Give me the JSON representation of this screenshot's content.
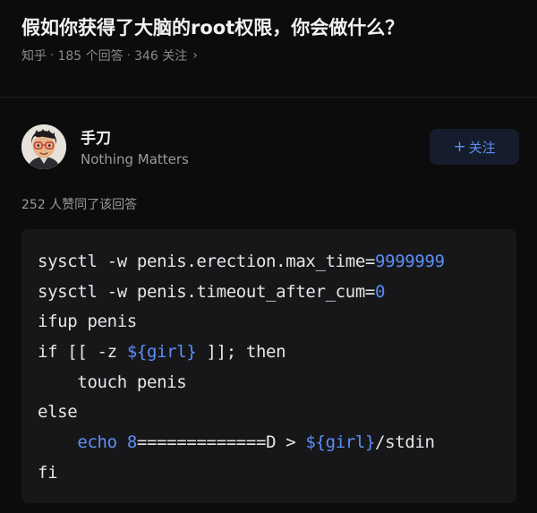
{
  "question": {
    "title": "假如你获得了大脑的root权限，你会做什么？",
    "source": "知乎",
    "answers": "185 个回答",
    "followers": "346 关注",
    "chevron": "›"
  },
  "author": {
    "name": "手刀",
    "bio": "Nothing Matters",
    "avatar_icon": "cartoon-avatar-icon",
    "follow_plus": "+",
    "follow_label": "关注"
  },
  "answer": {
    "agree_text": "252 人赞同了该回答"
  },
  "colors": {
    "background": "#0c0c0d",
    "code_background": "#17171a",
    "accent_blue": "#5b8ff5",
    "follow_button_bg": "#151c2b"
  },
  "code": {
    "lines": [
      [
        {
          "t": "sysctl -w penis.erection.max_time=",
          "c": "white"
        },
        {
          "t": "9999999",
          "c": "blue"
        }
      ],
      [
        {
          "t": "sysctl -w penis.timeout_after_cum=",
          "c": "white"
        },
        {
          "t": "0",
          "c": "blue"
        }
      ],
      [
        {
          "t": "ifup penis",
          "c": "white"
        }
      ],
      [
        {
          "t": "if [[ -z ",
          "c": "white"
        },
        {
          "t": "${girl}",
          "c": "blue"
        },
        {
          "t": " ]]; then",
          "c": "white"
        }
      ],
      [
        {
          "t": "    touch penis",
          "c": "white"
        }
      ],
      [
        {
          "t": "else",
          "c": "white"
        }
      ],
      [
        {
          "t": "    ",
          "c": "white"
        },
        {
          "t": "echo",
          "c": "blue"
        },
        {
          "t": " ",
          "c": "white"
        },
        {
          "t": "8",
          "c": "blue"
        },
        {
          "t": "=============D > ",
          "c": "white"
        },
        {
          "t": "${girl}",
          "c": "blue"
        },
        {
          "t": "/stdin",
          "c": "white"
        }
      ],
      [
        {
          "t": "fi",
          "c": "white"
        }
      ]
    ]
  }
}
